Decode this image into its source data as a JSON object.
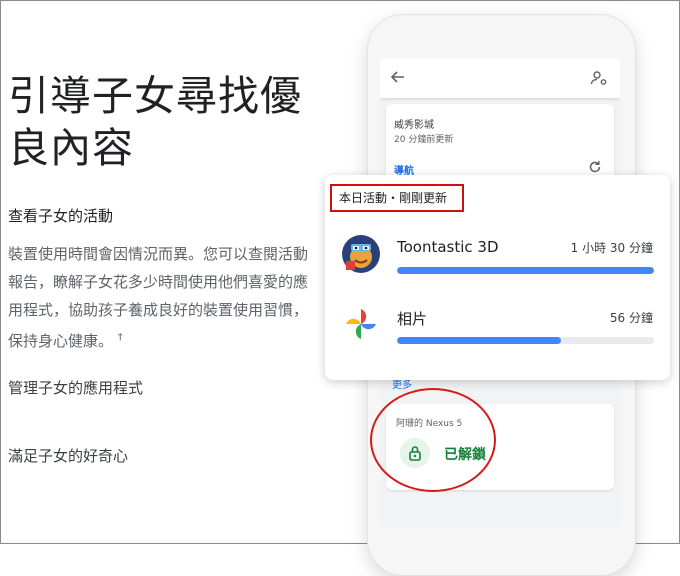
{
  "left": {
    "title": "引導子女尋找優良內容",
    "sections": [
      {
        "title": "查看子女的活動"
      },
      {
        "title": "管理子女的應用程式"
      },
      {
        "title": "滿足子女的好奇心"
      }
    ],
    "description": "裝置使用時間會因情況而異。您可以查閱活動報告，瞭解子女花多少時間使用他們喜愛的應用程式，協助孩子養成良好的裝置使用習慣，保持身心健康。",
    "footnote_mark": "†"
  },
  "phone": {
    "location_card": {
      "name": "威秀影城",
      "updated": "20 分鐘前更新",
      "navigate_label": "導航"
    },
    "more_label": "更多",
    "device_card": {
      "device_name": "阿珊的 Nexus 5",
      "lock_status": "已解鎖"
    }
  },
  "activity": {
    "header": "本日活動・剛剛更新",
    "apps": [
      {
        "name": "Toontastic 3D",
        "time": "1 小時 30 分鐘",
        "progress": 1.0,
        "icon": "toontastic-app-icon"
      },
      {
        "name": "相片",
        "time": "56 分鐘",
        "progress": 0.64,
        "icon": "google-photos-icon"
      }
    ]
  },
  "colors": {
    "accent_blue": "#4285f4",
    "link_blue": "#1a73e8",
    "unlocked_green": "#188038",
    "annotation_red": "#d61a1a"
  }
}
